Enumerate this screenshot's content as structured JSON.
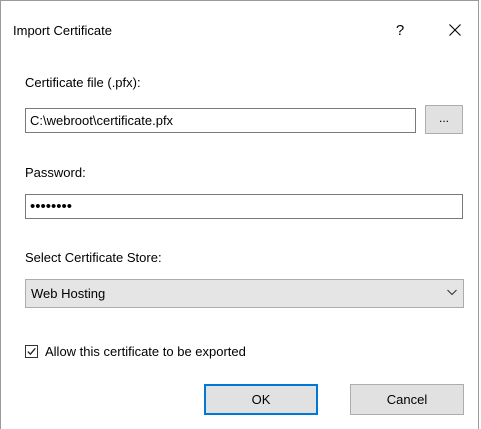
{
  "dialog": {
    "title": "Import Certificate",
    "help_label": "?",
    "close_icon": "close-icon"
  },
  "certificate_file": {
    "label": "Certificate file (.pfx):",
    "value": "C:\\webroot\\certificate.pfx",
    "browse_label": "..."
  },
  "password": {
    "label": "Password:",
    "value": "••••••••"
  },
  "store": {
    "label": "Select Certificate Store:",
    "selected": "Web Hosting",
    "arrow_icon": "chevron-down-icon"
  },
  "export_option": {
    "label": "Allow this certificate to be exported",
    "checked": true,
    "check_icon": "checkmark-icon"
  },
  "buttons": {
    "ok_label": "OK",
    "cancel_label": "Cancel"
  },
  "colors": {
    "accent": "#0078d7",
    "button_bg": "#e1e1e1",
    "select_bg": "#e5e5e5"
  }
}
